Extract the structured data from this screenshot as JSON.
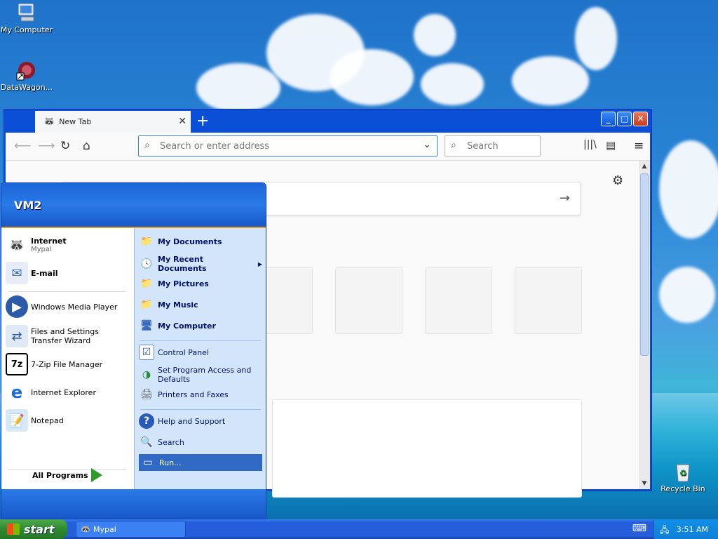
{
  "desktop": {
    "icons": [
      {
        "label": "My Computer",
        "icon": "my-computer-icon"
      },
      {
        "label": "DataWagon...",
        "icon": "datawagon-icon"
      },
      {
        "label": "Recycle Bin",
        "icon": "recycle-bin-icon"
      }
    ]
  },
  "browser": {
    "tab_title": "New Tab",
    "url_placeholder": "Search or enter address",
    "search_placeholder": "Search"
  },
  "start_menu": {
    "user": "VM2",
    "pinned": [
      {
        "label": "Internet",
        "sub": "Mypal"
      },
      {
        "label": "E-mail"
      }
    ],
    "recent": [
      {
        "label": "Windows Media Player"
      },
      {
        "label": "Files and Settings Transfer Wizard"
      },
      {
        "label": "7-Zip File Manager"
      },
      {
        "label": "Internet Explorer"
      },
      {
        "label": "Notepad"
      }
    ],
    "all_programs": "All Programs",
    "places": [
      {
        "label": "My Documents"
      },
      {
        "label": "My Recent Documents"
      },
      {
        "label": "My Pictures"
      },
      {
        "label": "My Music"
      },
      {
        "label": "My Computer"
      }
    ],
    "settings": [
      {
        "label": "Control Panel"
      },
      {
        "label": "Set Program Access and Defaults"
      },
      {
        "label": "Printers and Faxes"
      }
    ],
    "tools": [
      {
        "label": "Help and Support"
      },
      {
        "label": "Search"
      },
      {
        "label": "Run..."
      }
    ]
  },
  "taskbar": {
    "start_label": "start",
    "task": "Mypal",
    "clock": "3:51 AM"
  }
}
